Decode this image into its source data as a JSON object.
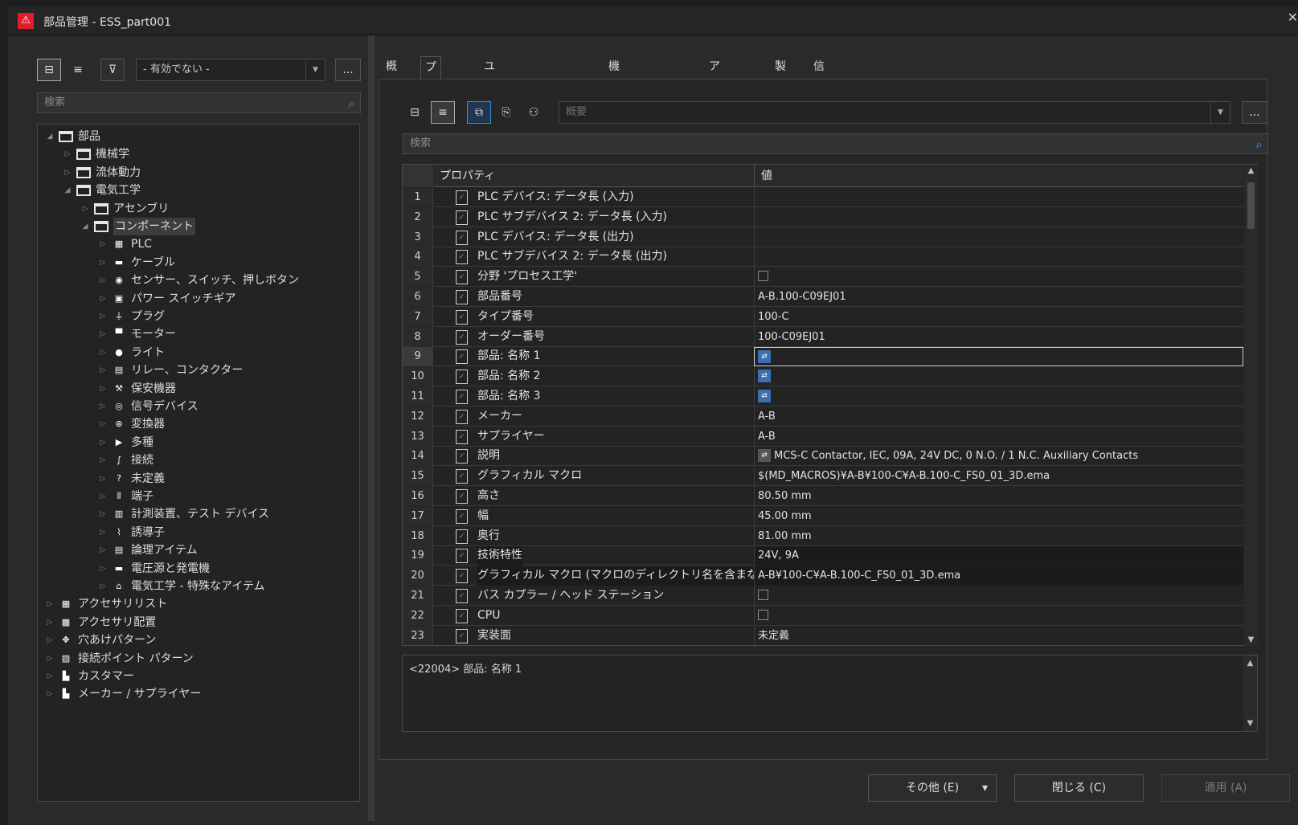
{
  "window": {
    "title": "部品管理 - ESS_part001",
    "title_icon": "⚠",
    "close": "✕"
  },
  "left": {
    "toolbar": {
      "tree_view_icon": "⊟",
      "list_view_icon": "≡",
      "filter_icon": "⊽",
      "filter_value": "- 有効でない -",
      "more": "..."
    },
    "search_placeholder": "検索",
    "tree": [
      {
        "label": "部品",
        "icon": "",
        "level": 0,
        "exp": "◢"
      },
      {
        "label": "機械学",
        "icon": "",
        "level": 1,
        "exp": "▷"
      },
      {
        "label": "流体動力",
        "icon": "",
        "level": 1,
        "exp": "▷"
      },
      {
        "label": "電気工学",
        "icon": "",
        "level": 1,
        "exp": "◢"
      },
      {
        "label": "アセンブリ",
        "icon": "",
        "level": 2,
        "exp": "▷"
      },
      {
        "label": "コンポーネント",
        "icon": "",
        "level": 2,
        "exp": "◢"
      },
      {
        "label": "PLC",
        "icon": "▦",
        "level": 3,
        "exp": "▷"
      },
      {
        "label": "ケーブル",
        "icon": "▬",
        "level": 3,
        "exp": "▷"
      },
      {
        "label": "センサー、スイッチ、押しボタン",
        "icon": "◉",
        "level": 3,
        "exp": "▷"
      },
      {
        "label": "パワー スイッチギア",
        "icon": "▣",
        "level": 3,
        "exp": "▷"
      },
      {
        "label": "プラグ",
        "icon": "⏚",
        "level": 3,
        "exp": "▷"
      },
      {
        "label": "モーター",
        "icon": "▀",
        "level": 3,
        "exp": "▷"
      },
      {
        "label": "ライト",
        "icon": "●",
        "level": 3,
        "exp": "▷"
      },
      {
        "label": "リレー、コンタクター",
        "icon": "▤",
        "level": 3,
        "exp": "▷"
      },
      {
        "label": "保安機器",
        "icon": "⚒",
        "level": 3,
        "exp": "▷"
      },
      {
        "label": "信号デバイス",
        "icon": "◎",
        "level": 3,
        "exp": "▷"
      },
      {
        "label": "変換器",
        "icon": "⊛",
        "level": 3,
        "exp": "▷"
      },
      {
        "label": "多種",
        "icon": "▶",
        "level": 3,
        "exp": "▷"
      },
      {
        "label": "接続",
        "icon": "∫",
        "level": 3,
        "exp": "▷"
      },
      {
        "label": "未定義",
        "icon": "?",
        "level": 3,
        "exp": "▷"
      },
      {
        "label": "端子",
        "icon": "⫴",
        "level": 3,
        "exp": "▷"
      },
      {
        "label": "計測装置、テスト デバイス",
        "icon": "▥",
        "level": 3,
        "exp": "▷"
      },
      {
        "label": "誘導子",
        "icon": "⌇",
        "level": 3,
        "exp": "▷"
      },
      {
        "label": "論理アイテム",
        "icon": "▤",
        "level": 3,
        "exp": "▷"
      },
      {
        "label": "電圧源と発電機",
        "icon": "▬",
        "level": 3,
        "exp": "▷"
      },
      {
        "label": "電気工学 - 特殊なアイテム",
        "icon": "⌂",
        "level": 3,
        "exp": "▷"
      },
      {
        "label": "アクセサリリスト",
        "icon": "▦",
        "level": 0,
        "exp": "▷"
      },
      {
        "label": "アクセサリ配置",
        "icon": "▩",
        "level": 0,
        "exp": "▷"
      },
      {
        "label": "穴あけパターン",
        "icon": "✥",
        "level": 0,
        "exp": "▷"
      },
      {
        "label": "接続ポイント パターン",
        "icon": "▨",
        "level": 0,
        "exp": "▷"
      },
      {
        "label": "カスタマー",
        "icon": "▙",
        "level": 0,
        "exp": "▷"
      },
      {
        "label": "メーカー / サプライヤー",
        "icon": "▙",
        "level": 0,
        "exp": "▷"
      }
    ]
  },
  "tabs": [
    "概要",
    "プロパティ",
    "ユーザー定義プロパティ",
    "機能テンプレート",
    "アクセサリ",
    "製造",
    "信頼度"
  ],
  "props": {
    "toolbar": {
      "tree_icon": "⊟",
      "list_icon": "≡",
      "copy_icon": "⧉",
      "paste_icon": "⎘",
      "user_icon": "⚇",
      "category_placeholder": "概要",
      "more": "..."
    },
    "search_placeholder": "検索",
    "col_property": "プロパティ",
    "col_value": "値",
    "rows": [
      {
        "n": "1",
        "name": "PLC デバイス: データ長 (入力)",
        "value": "",
        "type": "text"
      },
      {
        "n": "2",
        "name": "PLC サブデバイス 2: データ長 (入力)",
        "value": "",
        "type": "text"
      },
      {
        "n": "3",
        "name": "PLC デバイス: データ長 (出力)",
        "value": "",
        "type": "text"
      },
      {
        "n": "4",
        "name": "PLC サブデバイス 2: データ長 (出力)",
        "value": "",
        "type": "text"
      },
      {
        "n": "5",
        "name": "分野 'プロセス工学'",
        "value": "",
        "type": "checkbox"
      },
      {
        "n": "6",
        "name": "部品番号",
        "value": "A-B.100-C09EJ01",
        "type": "text"
      },
      {
        "n": "7",
        "name": "タイプ番号",
        "value": "100-C",
        "type": "text"
      },
      {
        "n": "8",
        "name": "オーダー番号",
        "value": "100-C09EJ01",
        "type": "text"
      },
      {
        "n": "9",
        "name": "部品: 名称 1",
        "value": "",
        "type": "icon",
        "selected": true
      },
      {
        "n": "10",
        "name": "部品: 名称 2",
        "value": "",
        "type": "icon"
      },
      {
        "n": "11",
        "name": "部品: 名称 3",
        "value": "",
        "type": "icon"
      },
      {
        "n": "12",
        "name": "メーカー",
        "value": "A-B",
        "type": "text"
      },
      {
        "n": "13",
        "name": "サプライヤー",
        "value": "A-B",
        "type": "text"
      },
      {
        "n": "14",
        "name": "説明",
        "value": "MCS-C Contactor, IEC, 09A, 24V DC, 0 N.O. / 1 N.C. Auxiliary Contacts",
        "type": "icontext"
      },
      {
        "n": "15",
        "name": "グラフィカル マクロ",
        "value": "$(MD_MACROS)¥A-B¥100-C¥A-B.100-C_FS0_01_3D.ema",
        "type": "text"
      },
      {
        "n": "16",
        "name": "高さ",
        "value": "80.50 mm",
        "type": "text"
      },
      {
        "n": "17",
        "name": "幅",
        "value": "45.00 mm",
        "type": "text"
      },
      {
        "n": "18",
        "name": "奥行",
        "value": "81.00 mm",
        "type": "text"
      },
      {
        "n": "19",
        "name": "技術特性",
        "value": "24V, 9A",
        "type": "text",
        "dark": true
      },
      {
        "n": "20",
        "name": "グラフィカル マクロ (マクロのディレクトリ名を含まない)",
        "value": "A-B¥100-C¥A-B.100-C_FS0_01_3D.ema",
        "type": "text",
        "dark": true
      },
      {
        "n": "21",
        "name": "バス カプラー / ヘッド ステーション",
        "value": "",
        "type": "checkbox"
      },
      {
        "n": "22",
        "name": "CPU",
        "value": "",
        "type": "checkbox"
      },
      {
        "n": "23",
        "name": "実装面",
        "value": "未定義",
        "type": "text"
      }
    ],
    "description": "<22004> 部品: 名称 1"
  },
  "footer": {
    "other": "その他 (E)",
    "other_arrow": "▾",
    "close": "閉じる (C)",
    "apply": "適用 (A)"
  }
}
